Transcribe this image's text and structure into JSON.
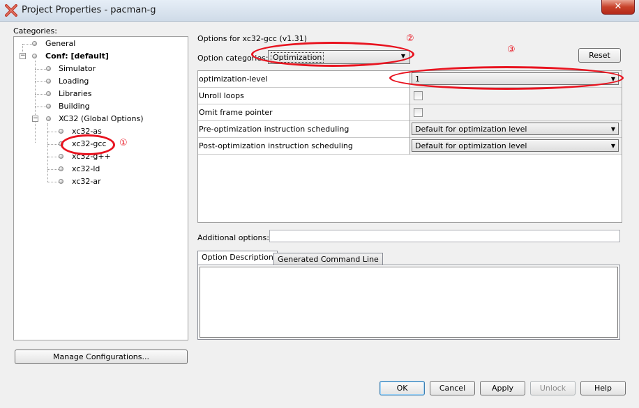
{
  "window": {
    "title": "Project Properties - pacman-g",
    "close_glyph": "✕"
  },
  "categories": {
    "label": "Categories:",
    "items": [
      {
        "label": "General"
      },
      {
        "label": "Conf: [default]"
      },
      {
        "label": "Simulator"
      },
      {
        "label": "Loading"
      },
      {
        "label": "Libraries"
      },
      {
        "label": "Building"
      },
      {
        "label": "XC32 (Global Options)"
      },
      {
        "label": "xc32-as"
      },
      {
        "label": "xc32-gcc"
      },
      {
        "label": "xc32-g++"
      },
      {
        "label": "xc32-ld"
      },
      {
        "label": "xc32-ar"
      }
    ],
    "manage_button": "Manage Configurations..."
  },
  "options": {
    "header": "Options for xc32-gcc (v1.31)",
    "category_label": "Option categories:",
    "category_value": "Optimization",
    "reset_button": "Reset",
    "rows": [
      {
        "name": "optimization-level",
        "type": "combo",
        "value": "1"
      },
      {
        "name": "Unroll loops",
        "type": "checkbox",
        "checked": false
      },
      {
        "name": "Omit frame pointer",
        "type": "checkbox",
        "checked": false
      },
      {
        "name": "Pre-optimization instruction scheduling",
        "type": "combo",
        "value": "Default for optimization level"
      },
      {
        "name": "Post-optimization instruction scheduling",
        "type": "combo",
        "value": "Default for optimization level"
      }
    ],
    "additional_label": "Additional options:",
    "additional_value": "",
    "tabs": [
      {
        "label": "Option Description",
        "active": true
      },
      {
        "label": "Generated Command Line",
        "active": false
      }
    ]
  },
  "annotations": [
    "①",
    "②",
    "③"
  ],
  "buttons": {
    "ok": "OK",
    "cancel": "Cancel",
    "apply": "Apply",
    "unlock": "Unlock",
    "help": "Help"
  },
  "colors": {
    "annotation_red": "#e8131f",
    "titlebar": "#d6e2ee"
  }
}
